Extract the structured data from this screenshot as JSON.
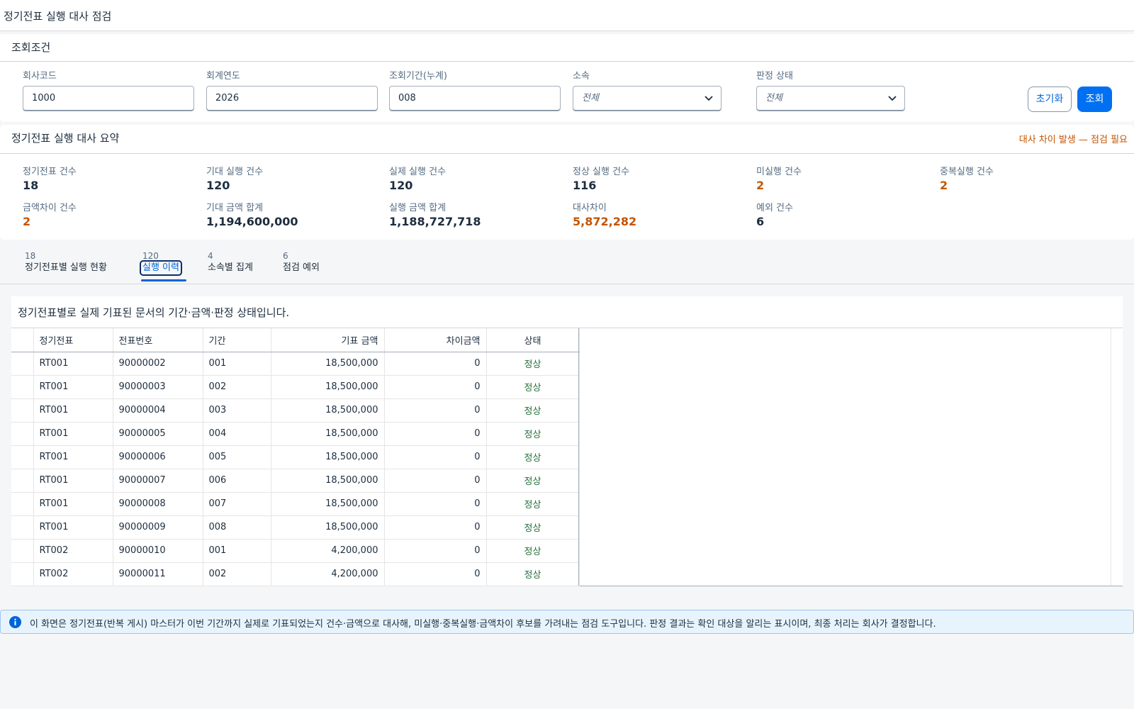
{
  "page": {
    "title": "정기전표 실행 대사 점검"
  },
  "filter": {
    "header": "조회조건",
    "company_code": {
      "label": "회사코드",
      "value": "1000"
    },
    "fiscal_year": {
      "label": "회계연도",
      "value": "2026"
    },
    "period": {
      "label": "조회기간(누계)",
      "value": "008"
    },
    "affiliation": {
      "label": "소속",
      "value": "전체"
    },
    "status": {
      "label": "판정 상태",
      "value": "전체"
    },
    "reset_label": "초기화",
    "search_label": "조회"
  },
  "summary": {
    "header": "정기전표 실행 대사 요약",
    "warning": "대사 차이 발생 — 점검 필요",
    "kpis": [
      {
        "label": "정기전표 건수",
        "value": "18"
      },
      {
        "label": "기대 실행 건수",
        "value": "120"
      },
      {
        "label": "실제 실행 건수",
        "value": "120"
      },
      {
        "label": "정상 실행 건수",
        "value": "116"
      },
      {
        "label": "미실행 건수",
        "value": "2"
      },
      {
        "label": "중복실행 건수",
        "value": "2"
      },
      {
        "label": "금액차이 건수",
        "value": "2"
      },
      {
        "label": "기대 금액 합계",
        "value": "1,194,600,000"
      },
      {
        "label": "실행 금액 합계",
        "value": "1,188,727,718"
      },
      {
        "label": "대사차이",
        "value": "5,872,282"
      },
      {
        "label": "예외 건수",
        "value": "6"
      }
    ]
  },
  "tabs": [
    {
      "count": "18",
      "label": "정기전표별 실행 현황"
    },
    {
      "count": "120",
      "label": "실행 이력"
    },
    {
      "count": "4",
      "label": "소속별 집계"
    },
    {
      "count": "6",
      "label": "점검 예외"
    }
  ],
  "table": {
    "description": "정기전표별로 실제 기표된 문서의 기간·금액·판정 상태입니다.",
    "columns": [
      "정기전표",
      "전표번호",
      "기간",
      "기표 금액",
      "차이금액",
      "상태"
    ],
    "rows": [
      [
        "RT001",
        "90000002",
        "001",
        "18,500,000",
        "0",
        "정상"
      ],
      [
        "RT001",
        "90000003",
        "002",
        "18,500,000",
        "0",
        "정상"
      ],
      [
        "RT001",
        "90000004",
        "003",
        "18,500,000",
        "0",
        "정상"
      ],
      [
        "RT001",
        "90000005",
        "004",
        "18,500,000",
        "0",
        "정상"
      ],
      [
        "RT001",
        "90000006",
        "005",
        "18,500,000",
        "0",
        "정상"
      ],
      [
        "RT001",
        "90000007",
        "006",
        "18,500,000",
        "0",
        "정상"
      ],
      [
        "RT001",
        "90000008",
        "007",
        "18,500,000",
        "0",
        "정상"
      ],
      [
        "RT001",
        "90000009",
        "008",
        "18,500,000",
        "0",
        "정상"
      ],
      [
        "RT002",
        "90000010",
        "001",
        "4,200,000",
        "0",
        "정상"
      ],
      [
        "RT002",
        "90000011",
        "002",
        "4,200,000",
        "0",
        "정상"
      ]
    ]
  },
  "info": {
    "text": "이 화면은 정기전표(반복 게시) 마스터가 이번 기간까지 실제로 기표되었는지 건수·금액으로 대사해, 미실행·중복실행·금액차이 후보를 가려내는 점검 도구입니다. 판정 결과는 확인 대상을 알리는 표시이며, 최종 처리는 회사가 결정합니다."
  },
  "colors": {
    "accent": "#0070f2",
    "warning": "#c35500",
    "positive": "#256f3a",
    "info_bg": "#e8f4fd"
  }
}
